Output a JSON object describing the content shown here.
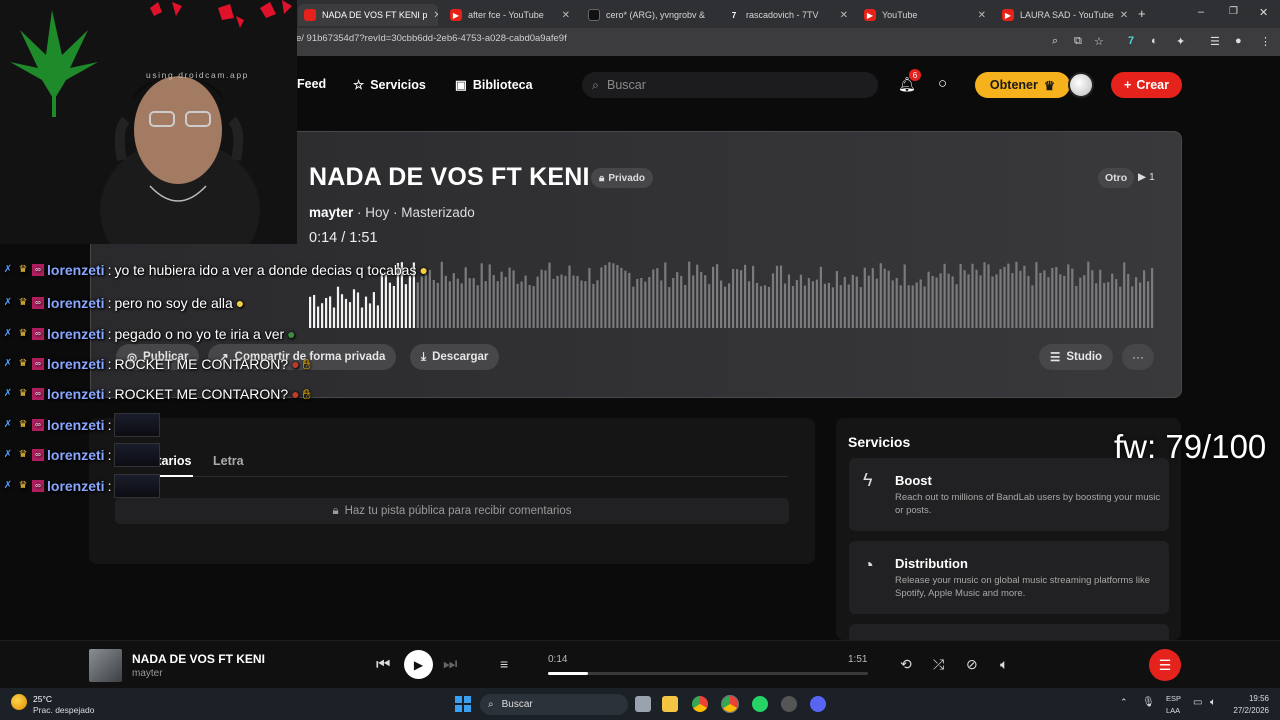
{
  "browser": {
    "tabs": [
      {
        "title": "NADA DE VOS FT KENI p",
        "active": true
      },
      {
        "title": "after fce - YouTube"
      },
      {
        "title": "cero* (ARG), yvngrobv &"
      },
      {
        "title": "rascadovich - 7TV"
      },
      {
        "title": "YouTube"
      },
      {
        "title": "LAURA SAD - YouTube"
      }
    ],
    "url": "e/ 91b67354d7?revId=30cbb6dd-2eb6-4753-a028-cabd0a9afe9f"
  },
  "nav": {
    "feed": "Feed",
    "services": "Servicios",
    "library": "Biblioteca",
    "search_placeholder": "Buscar",
    "notif_count": "6",
    "get": "Obtener",
    "create": "Crear"
  },
  "track": {
    "title": "NADA DE VOS FT KENI",
    "visibility": "Privado",
    "artist": "mayter",
    "meta": " · Hoy · Masterizado",
    "time": "0:14 / 1:51",
    "type": "Otro",
    "plays": "1",
    "progress_fraction": 0.126,
    "actions": {
      "publish": "Publicar",
      "share": "Compartir de forma privada",
      "download": "Descargar",
      "studio": "Studio"
    }
  },
  "comments": {
    "tab_comments": "Comentarios",
    "tab_lyrics": "Letra",
    "notice": "Haz tu pista pública para recibir comentarios"
  },
  "services": {
    "title": "Servicios",
    "items": [
      {
        "name": "Boost",
        "desc": "Reach out to millions of BandLab users by boosting your music or posts."
      },
      {
        "name": "Distribution",
        "desc": "Release your music on global music streaming platforms like Spotify, Apple Music and more."
      }
    ]
  },
  "player": {
    "title": "NADA DE VOS FT KENI",
    "artist": "mayter",
    "current": "0:14",
    "duration": "1:51"
  },
  "taskbar": {
    "temp": "25°C",
    "weather": "Prac. despejado",
    "search": "Buscar",
    "lang1": "ESP",
    "lang2": "LAA",
    "time": "19:56",
    "date": "27/2/2026"
  },
  "overlay": {
    "droidcam": "using droidcam.app",
    "fw": "fw: 79/100",
    "chat": [
      {
        "user": "lorenzeti",
        "msg": "yo te hubiera ido a ver a donde decias q tocabas"
      },
      {
        "user": "lorenzeti",
        "msg": "pero no soy de alla"
      },
      {
        "user": "lorenzeti",
        "msg": "pegado o no yo te iria a ver"
      },
      {
        "user": "lorenzeti",
        "msg": "ROCKET ME CONTARON?"
      },
      {
        "user": "lorenzeti",
        "msg": "ROCKET ME CONTARON?"
      },
      {
        "user": "lorenzeti",
        "msg": ""
      },
      {
        "user": "lorenzeti",
        "msg": ""
      },
      {
        "user": "lorenzeti",
        "msg": ""
      }
    ]
  },
  "colors": {
    "accent_red": "#e5231c",
    "accent_yellow": "#f6b21c",
    "chat_user": "#89a7ff"
  }
}
